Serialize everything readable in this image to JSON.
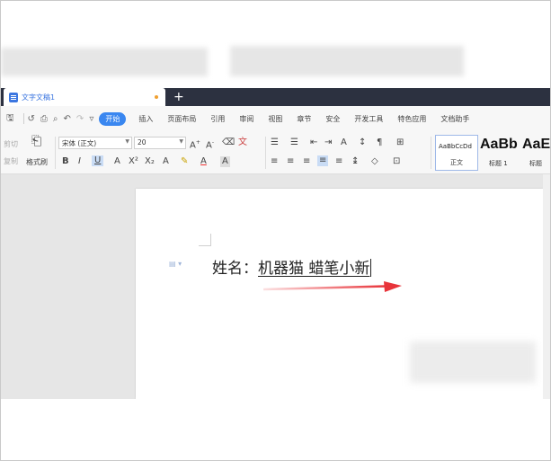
{
  "titlebar": {
    "doc_tab_label": "文字文稿1",
    "new_tab_symbol": "+"
  },
  "quick_access": {
    "icons": [
      "save-icon",
      "undo-history-icon",
      "print-icon",
      "print-preview-icon",
      "undo-icon",
      "redo-icon",
      "customize-icon"
    ]
  },
  "menu": {
    "items": [
      "开始",
      "插入",
      "页面布局",
      "引用",
      "审阅",
      "视图",
      "章节",
      "安全",
      "开发工具",
      "特色应用",
      "文档助手"
    ],
    "active_index": 0
  },
  "ribbon": {
    "cut_label": "剪切",
    "copy_label": "复制",
    "format_painter_label": "格式刷",
    "font_name": "宋体 (正文)",
    "font_size": "20",
    "styles": {
      "normal_preview": "AaBbCcDd",
      "normal_name": "正文",
      "heading1_preview": "AaBb",
      "heading1_name": "标题 1",
      "heading2_preview": "AaE",
      "heading2_name": "标题"
    }
  },
  "document": {
    "label": "姓名：",
    "value": "机器猫  蜡笔小新"
  },
  "colors": {
    "titlebar_bg": "#2c3140",
    "accent_blue": "#3a87f0",
    "arrow_red": "#e8343a"
  }
}
